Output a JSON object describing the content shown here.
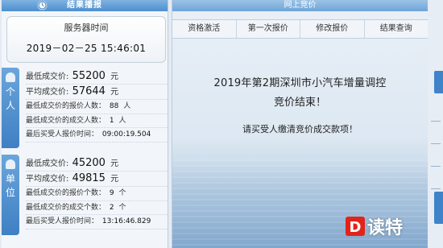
{
  "left_panel": {
    "header": "结果播报",
    "server": {
      "title": "服务器时间",
      "time": "2019－02－25 15:46:01"
    },
    "personal": {
      "tab_label": [
        "个",
        "人"
      ],
      "lowest_price": {
        "label": "最低成交价:",
        "value": "55200",
        "unit": "元"
      },
      "avg_price": {
        "label": "平均成交价:",
        "value": "57644",
        "unit": "元"
      },
      "lowest_bid_count": {
        "label": "最低成交价的报价人数：",
        "value": "88",
        "unit": "人"
      },
      "lowest_deal_count": {
        "label": "最低成交价的成交人数：",
        "value": "1",
        "unit": "人"
      },
      "last_bid_time": {
        "label": "最后买受人报价时间：",
        "value": "09:00:19.504"
      }
    },
    "company": {
      "tab_label": [
        "单",
        "位"
      ],
      "lowest_price": {
        "label": "最低成交价:",
        "value": "45200",
        "unit": "元"
      },
      "avg_price": {
        "label": "平均成交价:",
        "value": "49815",
        "unit": "元"
      },
      "lowest_bid_count": {
        "label": "最低成交价的报价个数：",
        "value": "9",
        "unit": "个"
      },
      "lowest_deal_count": {
        "label": "最低成交价的成交个数：",
        "value": "2",
        "unit": "个"
      },
      "last_bid_time": {
        "label": "最后买受人报价时间：",
        "value": "13:16:46.829"
      }
    }
  },
  "right_panel": {
    "header": "网上竞价",
    "tabs": [
      "资格激活",
      "第一次报价",
      "修改报价",
      "结果查询"
    ],
    "message_line1": "2019年第2期深圳市小汽车增量调控",
    "message_line2": "竞价结束！",
    "message_line3": "请买受人缴清竞价成交款项！"
  },
  "watermark": {
    "mark": "D",
    "text": "读特"
  },
  "colors": {
    "header_blue": "#4d8fcf",
    "tab_blue": "#3f7fc3",
    "watermark_red": "#e2231a"
  }
}
